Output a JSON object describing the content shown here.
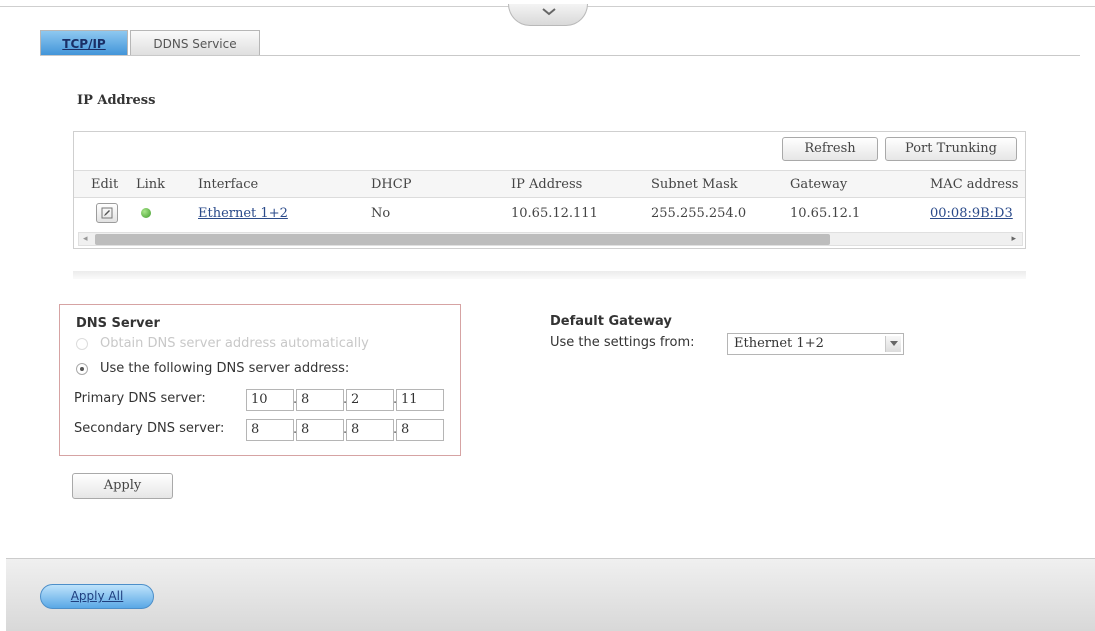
{
  "tabs": [
    {
      "label": "TCP/IP",
      "active": true
    },
    {
      "label": "DDNS Service",
      "active": false
    }
  ],
  "ip_section": {
    "title": "IP Address",
    "buttons": {
      "refresh": "Refresh",
      "port_trunking": "Port Trunking"
    },
    "columns": [
      "Edit",
      "Link",
      "Interface",
      "DHCP",
      "IP Address",
      "Subnet Mask",
      "Gateway",
      "MAC address"
    ],
    "rows": [
      {
        "interface": "Ethernet 1+2",
        "dhcp": "No",
        "ip": "10.65.12.111",
        "subnet": "255.255.254.0",
        "gateway": "10.65.12.1",
        "mac": "00:08:9B:D3"
      }
    ]
  },
  "dns": {
    "title": "DNS Server",
    "option_auto": "Obtain DNS server address automatically",
    "option_manual": "Use the following DNS server address:",
    "primary_label": "Primary DNS server:",
    "secondary_label": "Secondary DNS server:",
    "primary": [
      "10",
      "8",
      "2",
      "11"
    ],
    "secondary": [
      "8",
      "8",
      "8",
      "8"
    ]
  },
  "apply_label": "Apply",
  "gateway": {
    "title": "Default Gateway",
    "label": "Use the settings from:",
    "value": "Ethernet 1+2"
  },
  "apply_all_label": "Apply All",
  "colors": {
    "accent": "#3f93d8",
    "link_ok": "#3f9a2a"
  }
}
